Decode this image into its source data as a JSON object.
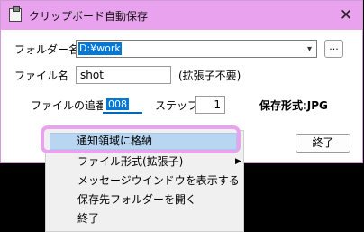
{
  "window": {
    "title": "クリップボード自動保存",
    "close_glyph": "✕"
  },
  "form": {
    "folder_label": "フォルダー名",
    "folder_value": "D:¥work",
    "browse_label": "...",
    "filename_label": "ファイル名",
    "filename_value": "shot",
    "extension_note": "(拡張子不要)",
    "sequence_label": "ファイルの追番",
    "sequence_value": "008",
    "step_label": "ステップ",
    "step_value": "1",
    "format_label": "保存形式:JPG",
    "close_button": "終了"
  },
  "context_menu": {
    "items": [
      {
        "label": "通知領域に格納",
        "highlighted": true
      },
      {
        "label": "ファイル形式(拡張子)",
        "submenu": true
      },
      {
        "label": "メッセージウインドウを表示する"
      },
      {
        "label": "保存先フォルダーを開く"
      },
      {
        "label": "終了"
      }
    ],
    "submenu_glyph": "▶"
  },
  "colors": {
    "titlebar": "#e9a2ee",
    "highlight_border": "#e9a2ee",
    "selection": "#0078d7",
    "menu_hover": "#b8d6f2"
  }
}
